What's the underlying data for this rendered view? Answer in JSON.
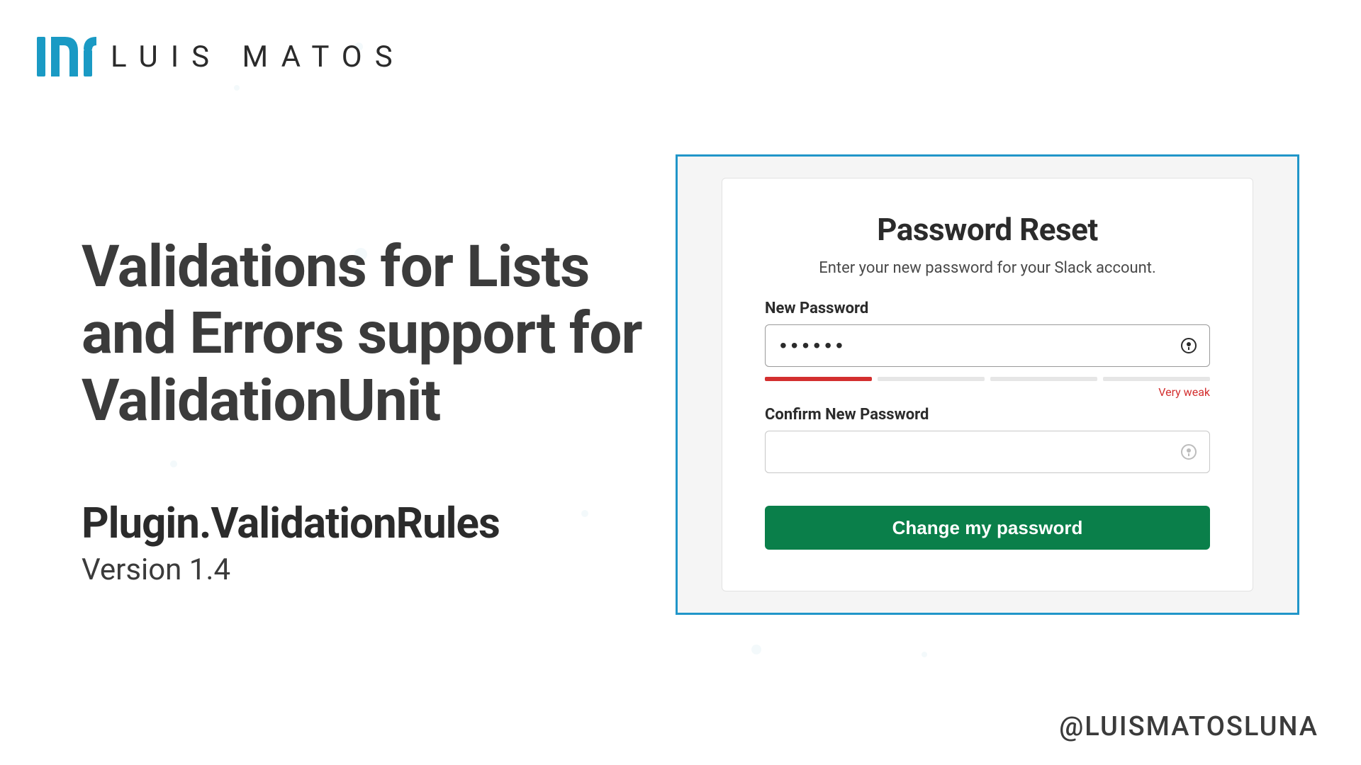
{
  "brand": {
    "name": "LUIS MATOS",
    "logo_color": "#1a9ac4"
  },
  "slide": {
    "title": "Validations for Lists and Errors support for ValidationUnit",
    "subtitle": "Plugin.ValidationRules",
    "version": "Version 1.4"
  },
  "form": {
    "title": "Password Reset",
    "subtitle": "Enter your new password for your Slack account.",
    "new_password_label": "New Password",
    "new_password_value": "••••••",
    "confirm_password_label": "Confirm New Password",
    "confirm_password_value": "",
    "strength_text": "Very weak",
    "strength_segments_active": 1,
    "strength_segments_total": 4,
    "submit_label": "Change my password",
    "colors": {
      "strength_active": "#d32f2f",
      "button_bg": "#0a7f4a",
      "frame_border": "#2196c9"
    }
  },
  "footer": {
    "handle": "@LUISMATOSLUNA"
  }
}
